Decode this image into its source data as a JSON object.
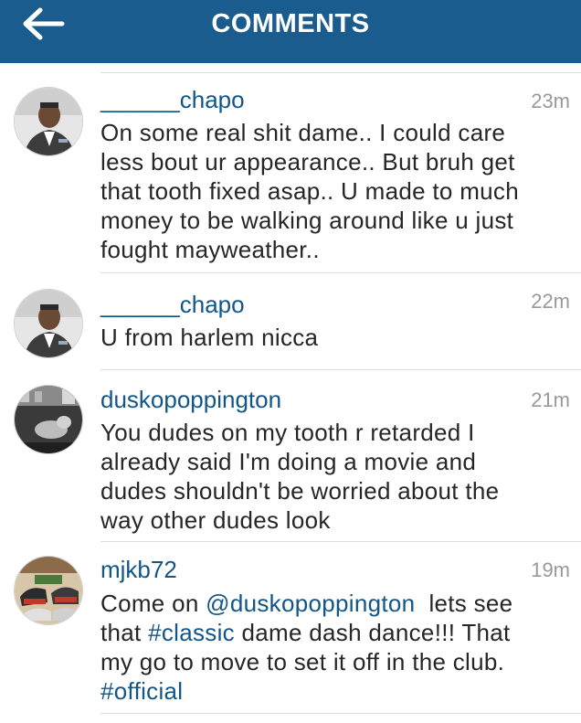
{
  "header": {
    "title": "COMMENTS",
    "background": "#195c8d",
    "back_icon": "arrow-left-icon"
  },
  "colors": {
    "link": "#125688",
    "text": "#262626",
    "time": "#999999",
    "divider": "#dedede"
  },
  "comments": [
    {
      "username": "______chapo",
      "time": "23m",
      "lines": [
        "On some real shit dame.. I could care",
        "less bout ur appearance.. But bruh get",
        "that tooth fixed asap.. U made to much",
        "money to be walking around like u just",
        "fought mayweather.."
      ]
    },
    {
      "username": "______chapo",
      "time": "22m",
      "lines": [
        "U from harlem nicca"
      ]
    },
    {
      "username": "duskopoppington",
      "time": "21m",
      "lines": [
        "You dudes on my tooth r retarded I",
        "already said I'm doing a movie and",
        "dudes shouldn't be worried about the",
        "way other dudes look"
      ]
    },
    {
      "username": "mjkb72",
      "time": "19m",
      "line1_prefix": "Come on ",
      "mention": "@duskopoppington",
      "line1_suffix": "  lets see",
      "line2_prefix": "that ",
      "hashtag1": "#classic",
      "line2_suffix": " dame dash dance!!! That",
      "line3": "my go to move to set it off in the club.",
      "hashtag2": "#official"
    }
  ]
}
